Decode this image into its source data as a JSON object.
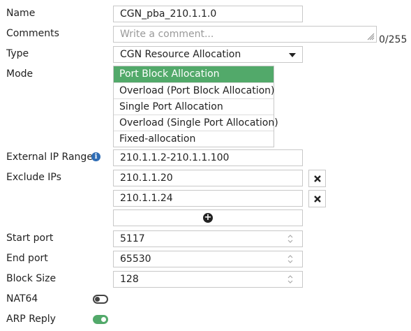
{
  "form": {
    "name": {
      "label": "Name",
      "value": "CGN_pba_210.1.1.0"
    },
    "comments": {
      "label": "Comments",
      "placeholder": "Write a comment...",
      "counter": "0/255"
    },
    "type": {
      "label": "Type",
      "value": "CGN Resource Allocation"
    },
    "mode": {
      "label": "Mode",
      "options": [
        "Port Block Allocation",
        "Overload (Port Block Allocation)",
        "Single Port Allocation",
        "Overload (Single Port Allocation)",
        "Fixed-allocation"
      ],
      "selected": "Port Block Allocation"
    },
    "external_ip_range": {
      "label": "External IP Range",
      "value": "210.1.1.2-210.1.1.100",
      "icon": "info-icon"
    },
    "exclude_ips": {
      "label": "Exclude IPs",
      "items": [
        "210.1.1.20",
        "210.1.1.24"
      ]
    },
    "start_port": {
      "label": "Start port",
      "value": "5117"
    },
    "end_port": {
      "label": "End port",
      "value": "65530"
    },
    "block_size": {
      "label": "Block Size",
      "value": "128"
    },
    "nat64": {
      "label": "NAT64",
      "enabled": false
    },
    "arp_reply": {
      "label": "ARP Reply",
      "enabled": true
    }
  },
  "colors": {
    "selected_bg": "#52a96a",
    "toggle_on": "#52a96a",
    "info_icon": "#2f6db5",
    "border": "#c8c8c8"
  }
}
